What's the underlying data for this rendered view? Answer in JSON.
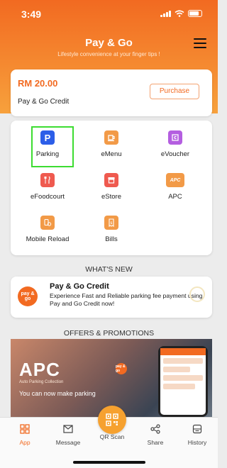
{
  "status": {
    "time": "3:49"
  },
  "header": {
    "title": "Pay & Go",
    "subtitle": "Lifestyle convenience at your finger tips !"
  },
  "credit": {
    "amount": "RM 20.00",
    "label": "Pay & Go Credit",
    "purchase_label": "Purchase"
  },
  "services": [
    {
      "label": "Parking",
      "icon": "parking-icon",
      "selected": true
    },
    {
      "label": "eMenu",
      "icon": "coffee-cup-icon"
    },
    {
      "label": "eVoucher",
      "icon": "voucher-icon"
    },
    {
      "label": "eFoodcourt",
      "icon": "fork-knife-icon"
    },
    {
      "label": "eStore",
      "icon": "store-icon"
    },
    {
      "label": "APC",
      "icon": "apc-icon"
    },
    {
      "label": "Mobile Reload",
      "icon": "mobile-reload-icon"
    },
    {
      "label": "Bills",
      "icon": "bill-icon"
    }
  ],
  "whats_new": {
    "section_title": "WHAT'S NEW",
    "logo_text": "pay & go",
    "title": "Pay & Go Credit",
    "body": "Experience Fast and Reliable parking fee payment using Pay and Go Credit now!"
  },
  "promotions": {
    "section_title": "OFFERS & PROMOTIONS",
    "banner_title": "APC",
    "banner_subtitle": "Auto Parking Collection",
    "banner_text": "You can now make parking",
    "logo_text": "pay & go"
  },
  "tabbar": {
    "items": [
      {
        "label": "App",
        "icon": "grid-icon",
        "active": true
      },
      {
        "label": "Message",
        "icon": "envelope-icon"
      },
      {
        "label": "QR Scan",
        "icon": "qr-code-icon"
      },
      {
        "label": "Share",
        "icon": "share-icon"
      },
      {
        "label": "History",
        "icon": "history-icon"
      }
    ]
  },
  "colors": {
    "brand": "#f26a21",
    "accent": "#f6a12f",
    "selection_outline": "#3ddc31"
  }
}
